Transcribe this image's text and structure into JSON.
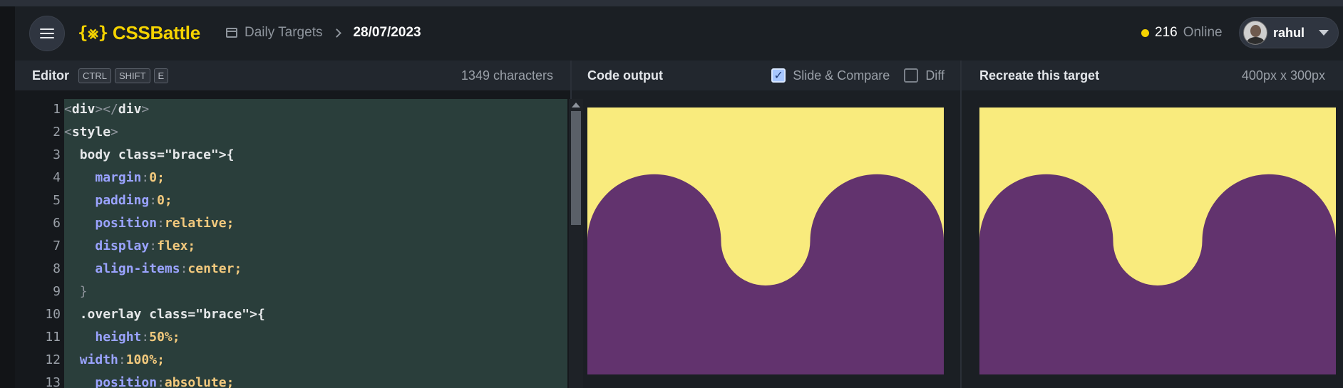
{
  "header": {
    "logo_mark": "{⨳}",
    "logo_text": "CSSBattle",
    "breadcrumb_link": "Daily Targets",
    "breadcrumb_current": "28/07/2023",
    "online_count": "216",
    "online_label": "Online",
    "username": "rahul"
  },
  "editor": {
    "title": "Editor",
    "shortcut_keys": [
      "CTRL",
      "SHIFT",
      "E"
    ],
    "char_count": "1349 characters",
    "line_numbers": [
      "1",
      "2",
      "3",
      "4",
      "5",
      "6",
      "7",
      "8",
      "9",
      "10",
      "11",
      "12",
      "13"
    ],
    "lines": [
      "<div></div>",
      "<style>",
      "  body{",
      "    margin:0;",
      "    padding:0;",
      "    position:relative;",
      "    display:flex;",
      "    align-items:center;",
      "  }",
      "  .overlay{",
      "    height:50%;",
      "  width:100%;",
      "    position:absolute;"
    ]
  },
  "output": {
    "title": "Code output",
    "slide_compare_label": "Slide & Compare",
    "slide_compare_checked": true,
    "diff_label": "Diff",
    "diff_checked": false
  },
  "target": {
    "title": "Recreate this target",
    "dimensions": "400px x 300px"
  },
  "colors": {
    "background_yellow": "#f9eb7d",
    "shape_purple": "#62336e",
    "accent_yellow": "#f5d300"
  }
}
